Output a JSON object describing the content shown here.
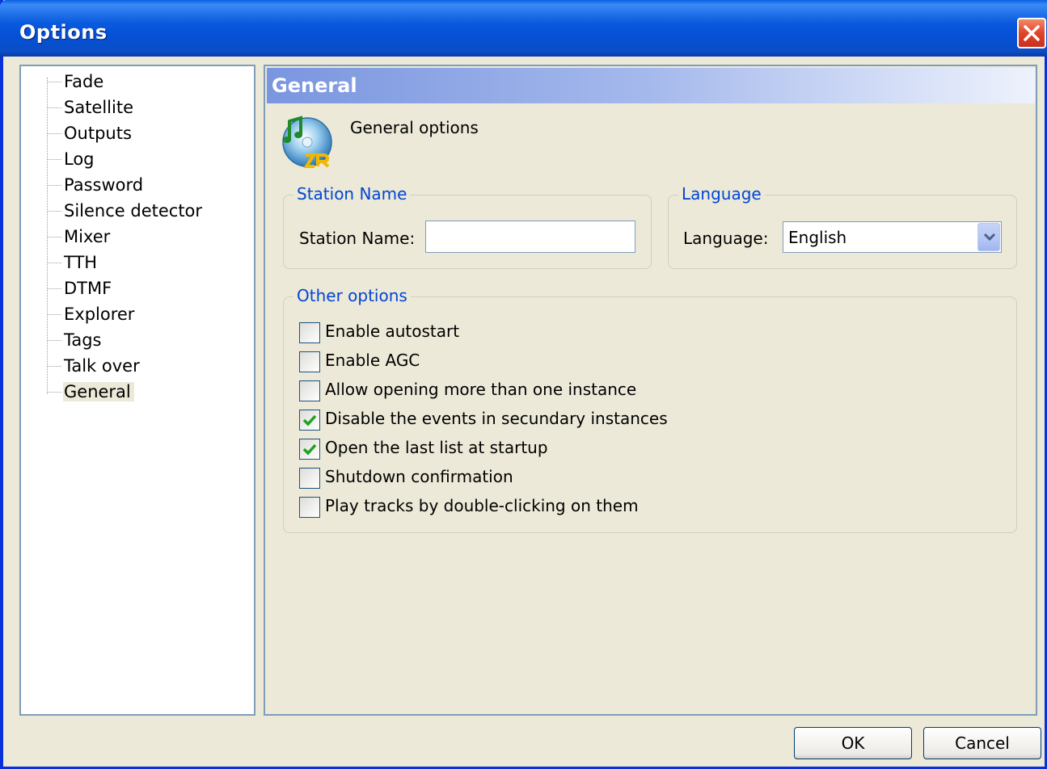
{
  "window": {
    "title": "Options"
  },
  "tree": {
    "items": [
      {
        "label": "Fade"
      },
      {
        "label": "Satellite"
      },
      {
        "label": "Outputs"
      },
      {
        "label": "Log"
      },
      {
        "label": "Password"
      },
      {
        "label": "Silence detector"
      },
      {
        "label": "Mixer"
      },
      {
        "label": "TTH"
      },
      {
        "label": "DTMF"
      },
      {
        "label": "Explorer"
      },
      {
        "label": "Tags"
      },
      {
        "label": "Talk over"
      },
      {
        "label": "General",
        "selected": true
      }
    ]
  },
  "panel": {
    "title": "General",
    "intro": "General options",
    "icon": "zararadio-disc-icon"
  },
  "station_group": {
    "title": "Station Name",
    "field_label": "Station Name:",
    "value": ""
  },
  "language_group": {
    "title": "Language",
    "field_label": "Language:",
    "selected": "English"
  },
  "other_group": {
    "title": "Other options",
    "checkboxes": [
      {
        "label": "Enable autostart",
        "checked": false
      },
      {
        "label": "Enable AGC",
        "checked": false
      },
      {
        "label": "Allow opening more than one instance",
        "checked": false
      },
      {
        "label": "Disable the events in secundary instances",
        "checked": true
      },
      {
        "label": "Open the last list at startup",
        "checked": true
      },
      {
        "label": "Shutdown confirmation",
        "checked": false
      },
      {
        "label": "Play tracks by double-clicking on them",
        "checked": false
      }
    ]
  },
  "buttons": {
    "ok": "OK",
    "cancel": "Cancel"
  },
  "colors": {
    "titlebar": "#0b5ade",
    "window_bg": "#ece9d8",
    "group_title": "#0046d5",
    "check": "#21a121"
  }
}
